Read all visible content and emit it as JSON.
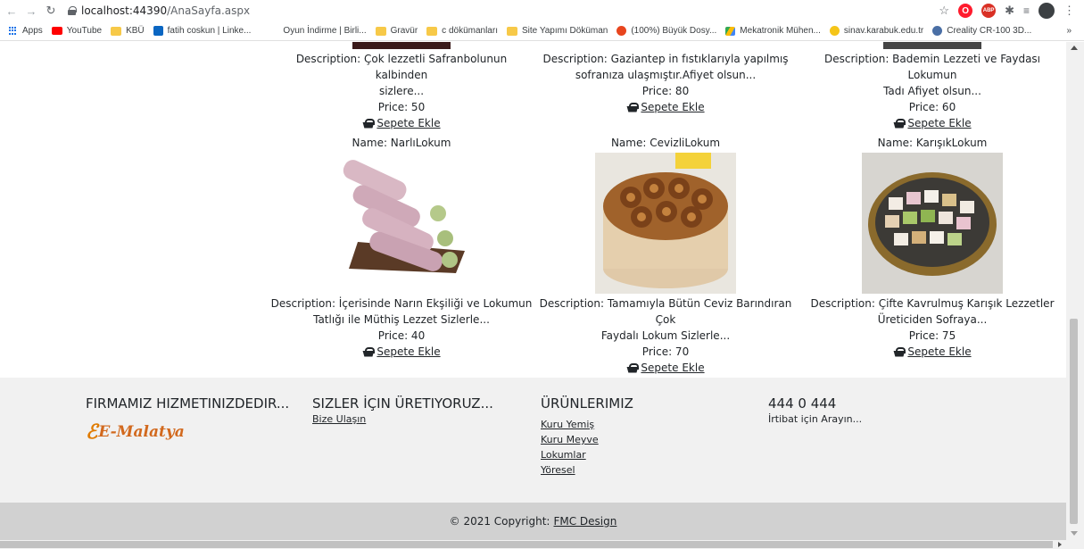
{
  "browser": {
    "url_host": "localhost:44390",
    "url_path": "/AnaSayfa.aspx",
    "bookmarks": [
      {
        "label": "Apps",
        "type": "apps"
      },
      {
        "label": "YouTube",
        "type": "youtube"
      },
      {
        "label": "KBÜ",
        "type": "folder"
      },
      {
        "label": "fatih coskun | Linke...",
        "type": "linkedin"
      },
      {
        "label": "Oyun İndirme | Birli...",
        "type": "plain"
      },
      {
        "label": "Gravür",
        "type": "folder"
      },
      {
        "label": "c dökümanları",
        "type": "folder"
      },
      {
        "label": "Site Yapımı Döküman",
        "type": "folder"
      },
      {
        "label": "(100%) Büyük Dosy...",
        "type": "opera"
      },
      {
        "label": "Mekatronik Mühen...",
        "type": "drive"
      },
      {
        "label": "sinav.karabuk.edu.tr",
        "type": "smile"
      },
      {
        "label": "Creality CR-100 3D...",
        "type": "creality"
      }
    ],
    "more_label": "»"
  },
  "products_top": [
    {
      "description_1": "Description: Çok lezzetli Safranbolunun kalbinden",
      "description_2": "sizlere...",
      "price": "Price: 50",
      "cart_label": "Sepete Ekle"
    },
    {
      "description_1": "Description: Gaziantep in fıstıklarıyla yapılmış",
      "description_2": "sofranıza ulaşmıştır.Afiyet olsun...",
      "price": "Price: 80",
      "cart_label": "Sepete Ekle"
    },
    {
      "description_1": "Description: Bademin Lezzeti ve Faydası Lokumun",
      "description_2": "Tadı Afiyet olsun...",
      "price": "Price: 60",
      "cart_label": "Sepete Ekle"
    }
  ],
  "products": [
    {
      "name": "Name: NarlıLokum",
      "description_1": "Description: İçerisinde Narın Ekşiliği ve Lokumun",
      "description_2": "Tatlığı ile Müthiş Lezzet Sizlerle...",
      "price": "Price: 40",
      "cart_label": "Sepete Ekle"
    },
    {
      "name": "Name: CevizliLokum",
      "description_1": "Description: Tamamıyla Bütün Ceviz Barındıran Çok",
      "description_2": "Faydalı Lokum Sizlerle...",
      "price": "Price: 70",
      "cart_label": "Sepete Ekle"
    },
    {
      "name": "Name: KarışıkLokum",
      "description_1": "Description: Çifte Kavrulmuş Karışık Lezzetler",
      "description_2": "Üreticiden Sofraya...",
      "price": "Price: 75",
      "cart_label": "Sepete Ekle"
    }
  ],
  "footer": {
    "col1": {
      "heading": "FIRMAMIZ HIZMETINIZDEDIR...",
      "logo": "E-Malatya"
    },
    "col2": {
      "heading": "SIZLER İÇIN ÜRETIYORUZ...",
      "link": "Bize Ulaşın"
    },
    "col3": {
      "heading": "ÜRÜNLERIMIZ",
      "links": [
        "Kuru Yemiş",
        "Kuru Meyve",
        "Lokumlar",
        "Yöresel"
      ]
    },
    "col4": {
      "heading": "444 0 444",
      "text": "İrtibat için Arayın..."
    },
    "copyright": "© 2021 Copyright:",
    "copyright_link": "FMC Design"
  }
}
